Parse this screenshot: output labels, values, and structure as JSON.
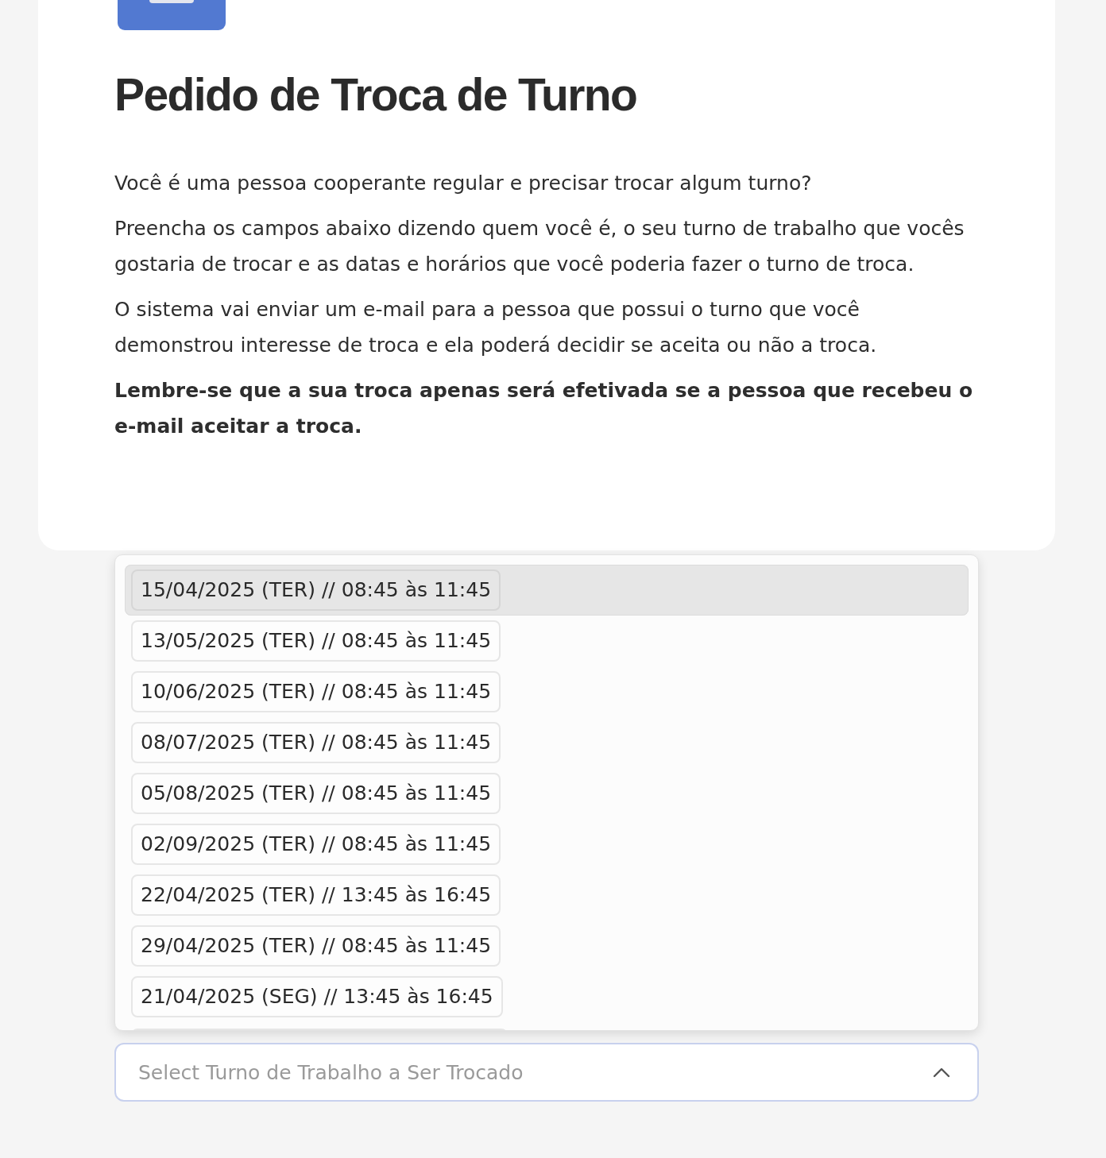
{
  "header": {
    "title": "Pedido de Troca de Turno"
  },
  "paragraphs": [
    {
      "text": "Você é uma pessoa cooperante regular e precisar trocar algum turno?",
      "bold": false
    },
    {
      "text": "Preencha os campos abaixo dizendo quem você é, o seu turno de trabalho que vocês gostaria de trocar e as datas e horários que você poderia fazer o turno de troca.",
      "bold": false
    },
    {
      "text": "O sistema vai enviar um e-mail para a pessoa que possui o turno que você demonstrou interesse de troca e ela poderá decidir se aceita ou não a troca.",
      "bold": false
    },
    {
      "text": "Lembre-se que a sua troca apenas será efetivada se a pessoa que recebeu o e-mail aceitar a troca.",
      "bold": true
    }
  ],
  "shift_select": {
    "placeholder": "Select Turno de Trabalho a Ser Trocado",
    "expanded": true,
    "options": [
      {
        "label": "15/04/2025 (TER) // 08:45 às 11:45",
        "selected": true
      },
      {
        "label": "13/05/2025 (TER) // 08:45 às 11:45",
        "selected": false
      },
      {
        "label": "10/06/2025 (TER) // 08:45 às 11:45",
        "selected": false
      },
      {
        "label": "08/07/2025 (TER) // 08:45 às 11:45",
        "selected": false
      },
      {
        "label": "05/08/2025 (TER) // 08:45 às 11:45",
        "selected": false
      },
      {
        "label": "02/09/2025 (TER) // 08:45 às 11:45",
        "selected": false
      },
      {
        "label": "22/04/2025 (TER) // 13:45 às 16:45",
        "selected": false
      },
      {
        "label": "29/04/2025 (TER) // 08:45 às 11:45",
        "selected": false
      },
      {
        "label": "21/04/2025 (SEG) // 13:45 às 16:45",
        "selected": false
      }
    ]
  }
}
